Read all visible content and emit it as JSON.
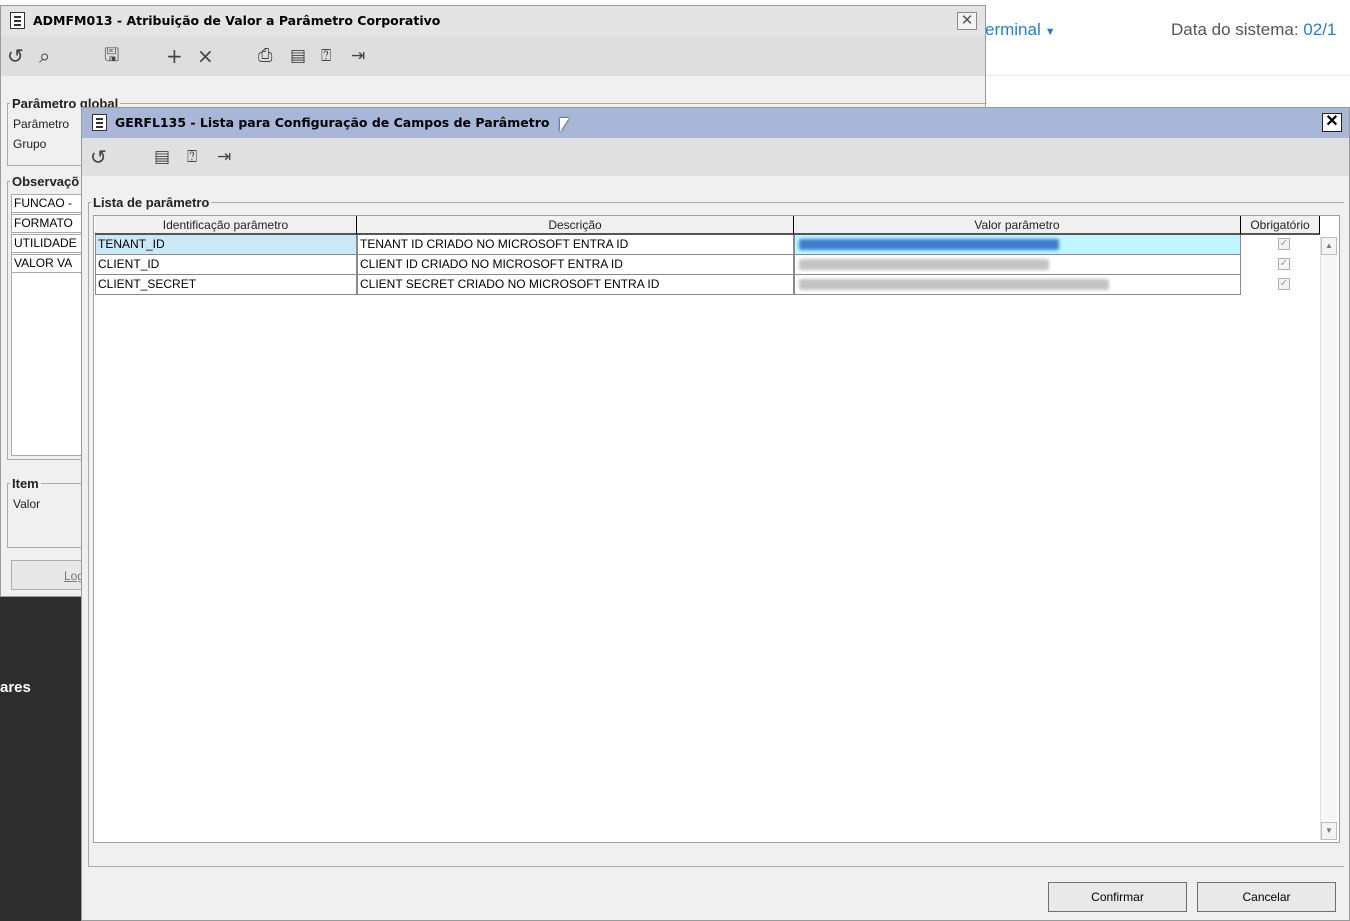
{
  "background": {
    "terminal_label": "erminal",
    "system_date_label": "Data do sistema:",
    "system_date_value": "02/1",
    "sidebar_text": "ares"
  },
  "window_main": {
    "title": "ADMFM013 - Atribuição de Valor a Parâmetro Corporativo",
    "toolbar_icons": [
      "undo-icon",
      "search-icon",
      "save-icon",
      "add-icon",
      "delete-icon",
      "print-icon",
      "calendar-icon",
      "help-icon",
      "exit-icon"
    ],
    "group_global": {
      "legend": "Parâmetro global",
      "label_parametro": "Parâmetro",
      "label_grupo": "Grupo"
    },
    "group_obs": {
      "legend": "Observaçõ",
      "lines": [
        "FUNCAO - ",
        "FORMATO ",
        "UTILIDADE",
        "VALOR VA"
      ]
    },
    "group_item": {
      "legend": "Item",
      "label_valor": "Valor"
    },
    "button_log": "Log"
  },
  "window_dialog": {
    "title": "GERFL135 - Lista para Configuração de Campos de Parâmetro",
    "toolbar_icons": [
      "undo-icon",
      "calendar-icon",
      "help-icon",
      "exit-icon"
    ],
    "group_legend": "Lista de parâmetro",
    "columns": [
      "Identificação parâmetro",
      "Descrição",
      "Valor parâmetro",
      "Obrigatório"
    ],
    "rows": [
      {
        "id": "TENANT_ID",
        "desc": "TENANT ID CRIADO NO MICROSOFT ENTRA ID",
        "value_redacted": true,
        "required": true,
        "selected": true
      },
      {
        "id": "CLIENT_ID",
        "desc": "CLIENT ID CRIADO NO MICROSOFT ENTRA ID",
        "value_redacted": true,
        "required": true,
        "selected": false
      },
      {
        "id": "CLIENT_SECRET",
        "desc": "CLIENT SECRET CRIADO NO MICROSOFT ENTRA ID",
        "value_redacted": true,
        "required": true,
        "selected": false
      }
    ],
    "button_confirm": "Confirmar",
    "button_cancel": "Cancelar"
  }
}
